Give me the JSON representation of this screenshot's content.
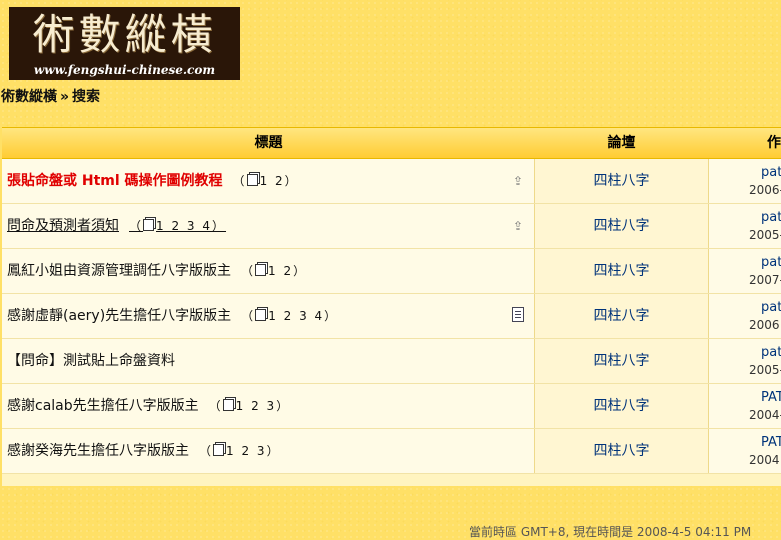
{
  "logo": {
    "title": "術數縱橫",
    "url": "www.fengshui-chinese.com"
  },
  "breadcrumb": {
    "home": "術數縱橫",
    "separator": "»",
    "current": "搜索"
  },
  "table": {
    "columns": [
      "標題",
      "論壇",
      "作"
    ],
    "rows": [
      {
        "title": "張貼命盤或 Html 碼操作圖例教程",
        "pages": "1 2",
        "forum": "四柱八字",
        "author": "patt",
        "date": "2006-",
        "icon": "pinned-icon"
      },
      {
        "title": "問命及預測者須知",
        "pages": "1 2 3 4",
        "forum": "四柱八字",
        "author": "patt",
        "date": "2005-",
        "icon": "pinned-icon"
      },
      {
        "title": "鳳紅小姐由資源管理調任八字版版主",
        "pages": "1 2",
        "forum": "四柱八字",
        "author": "patt",
        "date": "2007-",
        "icon": ""
      },
      {
        "title": "感謝虛靜(aery)先生擔任八字版版主",
        "pages": "1 2 3 4",
        "forum": "四柱八字",
        "author": "patt",
        "date": "2006",
        "icon": "document-icon"
      },
      {
        "title": "【問命】測試貼上命盤資料",
        "pages": "",
        "forum": "四柱八字",
        "author": "patt",
        "date": "2005-",
        "icon": ""
      },
      {
        "title": "感謝calab先生擔任八字版版主",
        "pages": "1 2 3",
        "forum": "四柱八字",
        "author": "PATT",
        "date": "2004-",
        "icon": ""
      },
      {
        "title": "感謝癸海先生擔任八字版版主",
        "pages": "1 2 3",
        "forum": "四柱八字",
        "author": "PATT",
        "date": "2004",
        "icon": ""
      }
    ]
  },
  "footer": {
    "timezone": "當前時區 GMT+8, 現在時間是 2008-4-5 04:11 PM"
  }
}
